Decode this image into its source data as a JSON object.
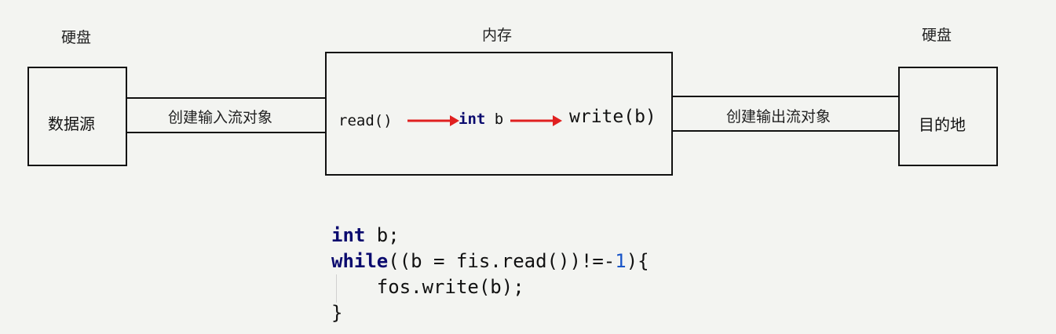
{
  "disk_left_label": "硬盘",
  "memory_label": "内存",
  "disk_right_label": "硬盘",
  "source_box": "数据源",
  "dest_box": "目的地",
  "input_stream_label": "创建输入流对象",
  "output_stream_label": "创建输出流对象",
  "memory_flow": {
    "read": "read()",
    "int_kw": "int",
    "var": " b",
    "write": "write(b)"
  },
  "code": {
    "line1_kw": "int",
    "line1_rest": " b;",
    "line2_kw": "while",
    "line2_rest": "((b = fis.read())!=-",
    "line2_num": "1",
    "line2_end": "){",
    "line3": "    fos.write(b);",
    "line4": "}"
  },
  "colors": {
    "arrow": "#e02020",
    "keyword": "#0a0a6e",
    "number": "#1a56c8"
  }
}
